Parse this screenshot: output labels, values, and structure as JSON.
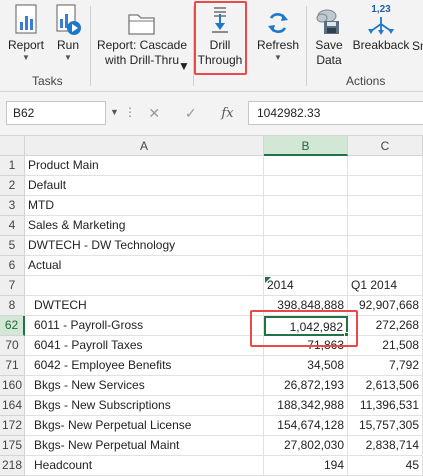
{
  "ribbon": {
    "report_label": "Report",
    "run_label": "Run",
    "report_cascade_label": "Report: Cascade\nwith Drill-Thru",
    "drill_through_label": "Drill\nThrough",
    "refresh_label": "Refresh",
    "save_data_label": "Save\nData",
    "breakback_label": "Breakback",
    "breakback_badge": "1,23",
    "truncated_label": "Sn",
    "group_tasks": "Tasks",
    "group_actions": "Actions",
    "icons": [
      "report-icon",
      "run-icon",
      "folder-icon",
      "drill-through-icon",
      "refresh-icon",
      "save-data-icon",
      "breakback-icon"
    ],
    "highlight_color": "#e84a4a"
  },
  "formula_bar": {
    "name_box": "B62",
    "cancel_icon": "✕",
    "enter_icon": "✓",
    "fx_label": "fx",
    "value": "1042982.33"
  },
  "grid": {
    "columns": [
      "A",
      "B",
      "C"
    ],
    "selected_column": "B",
    "rows": [
      {
        "num": "1",
        "a": "Product Main",
        "b": "",
        "c": ""
      },
      {
        "num": "2",
        "a": "Default",
        "b": "",
        "c": ""
      },
      {
        "num": "3",
        "a": "MTD",
        "b": "",
        "c": ""
      },
      {
        "num": "4",
        "a": "Sales & Marketing",
        "b": "",
        "c": ""
      },
      {
        "num": "5",
        "a": "DWTECH - DW Technology",
        "b": "",
        "c": ""
      },
      {
        "num": "6",
        "a": "Actual",
        "b": "",
        "c": ""
      },
      {
        "num": "7",
        "a": "",
        "b": "2014",
        "c": "Q1 2014"
      },
      {
        "num": "8",
        "a": "DWTECH",
        "b": "398,848,888",
        "c": "92,907,668"
      },
      {
        "num": "62",
        "a": "6011 - Payroll-Gross",
        "b": "1,042,982",
        "c": "272,268"
      },
      {
        "num": "70",
        "a": "6041 - Payroll Taxes",
        "b": "71,863",
        "c": "21,508"
      },
      {
        "num": "71",
        "a": "6042 - Employee Benefits",
        "b": "34,508",
        "c": "7,792"
      },
      {
        "num": "160",
        "a": "Bkgs - New Services",
        "b": "26,872,193",
        "c": "2,613,506"
      },
      {
        "num": "164",
        "a": "Bkgs - New Subscriptions",
        "b": "188,342,988",
        "c": "11,396,531"
      },
      {
        "num": "172",
        "a": "Bkgs- New Perpetual License",
        "b": "154,674,128",
        "c": "15,757,305"
      },
      {
        "num": "175",
        "a": "Bkgs- New Perpetual Maint",
        "b": "27,802,030",
        "c": "2,838,714"
      },
      {
        "num": "218",
        "a": "Headcount",
        "b": "194",
        "c": "45"
      }
    ],
    "active_cell": "B62",
    "accent_color": "#217346"
  }
}
